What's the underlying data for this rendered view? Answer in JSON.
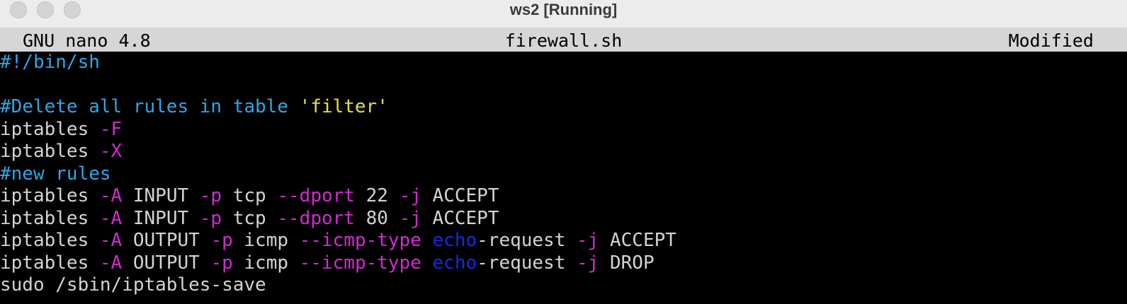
{
  "window": {
    "title": "ws2 [Running]"
  },
  "nano": {
    "version": "GNU nano 4.8",
    "filename": "firewall.sh",
    "status": "Modified"
  },
  "colors": {
    "comment": "#2ea7e6",
    "string": "#e3e33a",
    "flag": "#d22bd2",
    "keyword": "#1a28e6",
    "text": "#d4d4d4",
    "background": "#000000",
    "header_bg": "#d6d6d6"
  },
  "lines": [
    [
      {
        "t": "#!/bin/sh",
        "c": "comment"
      }
    ],
    [],
    [
      {
        "t": "#Delete all rules in table ",
        "c": "comment"
      },
      {
        "t": "'filter'",
        "c": "string"
      }
    ],
    [
      {
        "t": "iptables ",
        "c": "text"
      },
      {
        "t": "-F",
        "c": "flag"
      }
    ],
    [
      {
        "t": "iptables ",
        "c": "text"
      },
      {
        "t": "-X",
        "c": "flag"
      }
    ],
    [
      {
        "t": "#new rules",
        "c": "comment"
      }
    ],
    [
      {
        "t": "iptables ",
        "c": "text"
      },
      {
        "t": "-A",
        "c": "flag"
      },
      {
        "t": " INPUT ",
        "c": "text"
      },
      {
        "t": "-p",
        "c": "flag"
      },
      {
        "t": " tcp ",
        "c": "text"
      },
      {
        "t": "--dport",
        "c": "flag"
      },
      {
        "t": " 22 ",
        "c": "text"
      },
      {
        "t": "-j",
        "c": "flag"
      },
      {
        "t": " ACCEPT",
        "c": "text"
      }
    ],
    [
      {
        "t": "iptables ",
        "c": "text"
      },
      {
        "t": "-A",
        "c": "flag"
      },
      {
        "t": " INPUT ",
        "c": "text"
      },
      {
        "t": "-p",
        "c": "flag"
      },
      {
        "t": " tcp ",
        "c": "text"
      },
      {
        "t": "--dport",
        "c": "flag"
      },
      {
        "t": " 80 ",
        "c": "text"
      },
      {
        "t": "-j",
        "c": "flag"
      },
      {
        "t": " ACCEPT",
        "c": "text"
      }
    ],
    [
      {
        "t": "iptables ",
        "c": "text"
      },
      {
        "t": "-A",
        "c": "flag"
      },
      {
        "t": " OUTPUT ",
        "c": "text"
      },
      {
        "t": "-p",
        "c": "flag"
      },
      {
        "t": " icmp ",
        "c": "text"
      },
      {
        "t": "--icmp-type",
        "c": "flag"
      },
      {
        "t": " ",
        "c": "text"
      },
      {
        "t": "echo",
        "c": "keyword"
      },
      {
        "t": "-request ",
        "c": "text"
      },
      {
        "t": "-j",
        "c": "flag"
      },
      {
        "t": " ACCEPT",
        "c": "text"
      }
    ],
    [
      {
        "t": "iptables ",
        "c": "text"
      },
      {
        "t": "-A",
        "c": "flag"
      },
      {
        "t": " OUTPUT ",
        "c": "text"
      },
      {
        "t": "-p",
        "c": "flag"
      },
      {
        "t": " icmp ",
        "c": "text"
      },
      {
        "t": "--icmp-type",
        "c": "flag"
      },
      {
        "t": " ",
        "c": "text"
      },
      {
        "t": "echo",
        "c": "keyword"
      },
      {
        "t": "-request ",
        "c": "text"
      },
      {
        "t": "-j",
        "c": "flag"
      },
      {
        "t": " DROP",
        "c": "text"
      }
    ],
    [
      {
        "t": "sudo /sbin/iptables-save",
        "c": "text"
      }
    ]
  ]
}
